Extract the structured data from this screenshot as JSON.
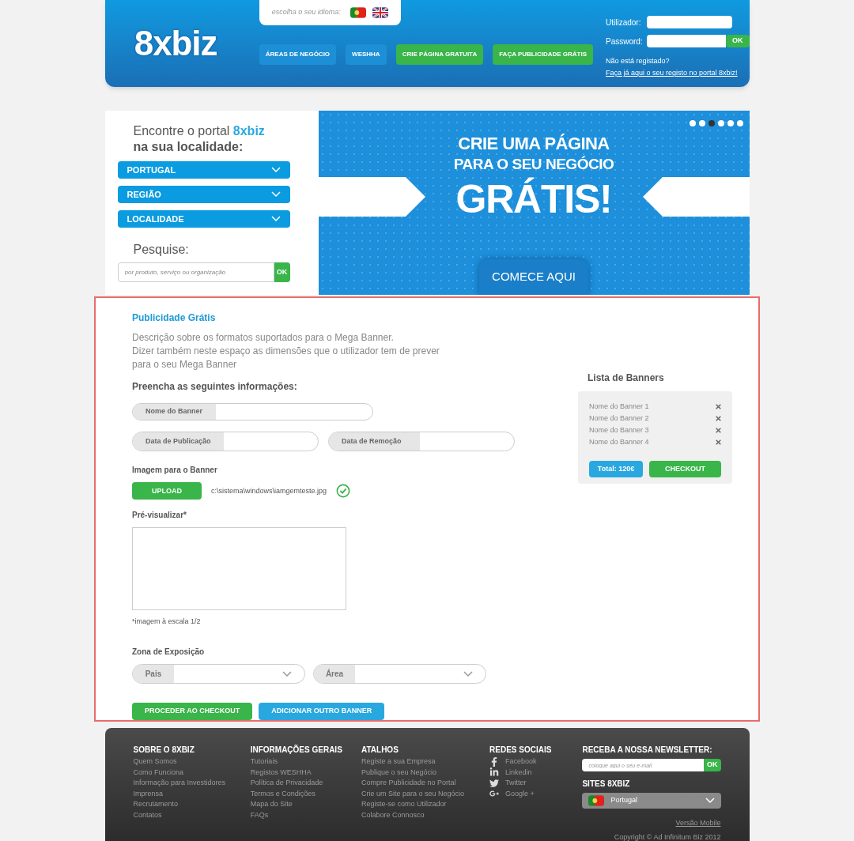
{
  "header": {
    "logo": "8xbiz",
    "language_label": "escolha o seu idioma:",
    "languages": [
      {
        "kind": "pt"
      },
      {
        "kind": "uk"
      }
    ],
    "nav": [
      {
        "label": "ÁREAS DE NEGÓCIO",
        "kind": "blue"
      },
      {
        "label": "WESHHA",
        "kind": "blue"
      },
      {
        "label": "CRIE PÁGINA GRATUITA",
        "kind": "green"
      },
      {
        "label": "FAÇA PUBLICIDADE GRÁTIS",
        "kind": "green"
      }
    ],
    "login": {
      "user_label": "Utilizador:",
      "password_label": "Password:",
      "ok": "OK",
      "register_question": "Não está registado?",
      "register_link": "Faça já aqui o seu registo no portal 8xbiz!"
    }
  },
  "finder": {
    "title": "Encontre o portal",
    "brand": "8xbiz",
    "title_line2": "na sua localidade:",
    "dropdowns": [
      "PORTUGAL",
      "REGIÃO",
      "LOCALIDADE"
    ],
    "search_label": "Pesquise:",
    "search_placeholder": "por produto, serviço ou organização",
    "search_button": "OK"
  },
  "banner": {
    "line1": "CRIE UMA PÁGINA",
    "line2": "PARA O SEU NEGÓCIO",
    "big": "GRÁTIS!",
    "cta": "COMECE AQUI",
    "dots": [
      {
        "selected": false
      },
      {
        "selected": false
      },
      {
        "selected": true
      },
      {
        "selected": false
      },
      {
        "selected": false
      },
      {
        "selected": false
      }
    ]
  },
  "form": {
    "title": "Publicidade Grátis",
    "description": [
      "Descrição sobre os formatos suportados para o Mega Banner.",
      "Dizer também neste espaço as dimensões que o utilizador tem de prever",
      "para o seu Mega Banner"
    ],
    "heading": "Preencha as seguintes informações:",
    "name_field": "Nome do Banner",
    "date_fields": [
      "Data de Publicação",
      "Data de Remoção"
    ],
    "image_label": "Imagem para o Banner",
    "upload": "UPLOAD",
    "file_path": "c:\\sistema\\windows\\iamgemteste.jpg",
    "upload_ok": true,
    "preview_label": "Pré-visualizar*",
    "preview_note": "*imagem à escala 1/2",
    "zone_label": "Zona de Exposição",
    "selects": [
      "Pais",
      "Área"
    ],
    "buttons": [
      {
        "label": "PROCEDER AO CHECKOUT",
        "kind": "green"
      },
      {
        "label": "ADICIONAR OUTRO BANNER",
        "kind": "blue"
      }
    ]
  },
  "banner_list": {
    "title": "Lista de Banners",
    "items": [
      "Nome do Banner 1",
      "Nome do Banner 2",
      "Nome do Banner 3",
      "Nome do Banner 4"
    ],
    "total": "Total: 120€",
    "checkout": "CHECKOUT"
  },
  "footer": {
    "columns": [
      {
        "title": "SOBRE O 8XBIZ",
        "links": [
          "Quem Somos",
          "Como Funciona",
          "Informação para Investidores",
          "Imprensa",
          "Recrutamento",
          "Contatos"
        ]
      },
      {
        "title": "INFORMAÇÕES GERAIS",
        "links": [
          "Tutoriais",
          "Registos WESHHA",
          "Política de Privacidade",
          "Termos e Condições",
          "Mapa do Site",
          "FAQs"
        ]
      },
      {
        "title": "ATALHOS",
        "links": [
          "Registe a sua Empresa",
          "Publique o seu Negócio",
          "Compre Publicidade no Portal",
          "Crie um Site para o seu Negócio",
          "Registe-se como Utilizador",
          "Colabore Connosco"
        ]
      }
    ],
    "social": {
      "title": "REDES SOCIAIS",
      "items": [
        {
          "label": "Facebook",
          "kind": "facebook"
        },
        {
          "label": "Linkedin",
          "kind": "linkedin"
        },
        {
          "label": "Twitter",
          "kind": "twitter"
        },
        {
          "label": "Google +",
          "kind": "google"
        }
      ]
    },
    "newsletter": {
      "title": "RECEBA A NOSSA NEWSLETTER:",
      "placeholder": "coloque aqui o seu e-mail",
      "ok": "OK"
    },
    "sites": {
      "title": "SITES 8XBIZ",
      "value": "Portugal"
    },
    "mobile_link": "Versão Mobile",
    "copyright": "Copyright © Ad Infinitum Biz 2012"
  }
}
